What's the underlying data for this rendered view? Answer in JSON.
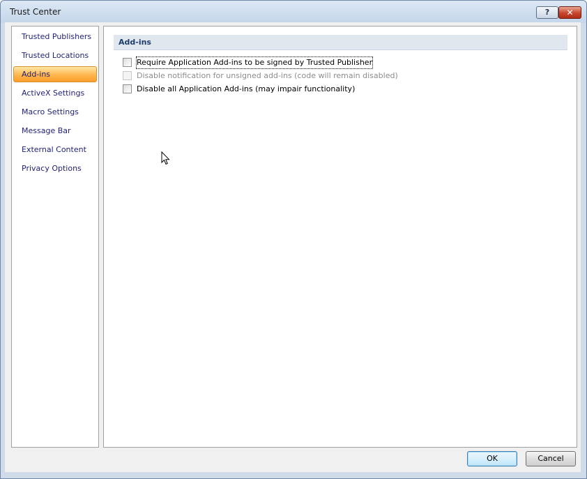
{
  "window": {
    "title": "Trust Center",
    "help_label": "?",
    "close_label": "✕"
  },
  "sidebar": {
    "items": [
      {
        "label": "Trusted Publishers",
        "selected": false
      },
      {
        "label": "Trusted Locations",
        "selected": false
      },
      {
        "label": "Add-ins",
        "selected": true
      },
      {
        "label": "ActiveX Settings",
        "selected": false
      },
      {
        "label": "Macro Settings",
        "selected": false
      },
      {
        "label": "Message Bar",
        "selected": false
      },
      {
        "label": "External Content",
        "selected": false
      },
      {
        "label": "Privacy Options",
        "selected": false
      }
    ]
  },
  "content": {
    "section_title": "Add-ins",
    "options": [
      {
        "label": "Require Application Add-ins to be signed by Trusted Publisher",
        "checked": false,
        "enabled": true,
        "focused": true
      },
      {
        "label": "Disable notification for unsigned add-ins (code will remain disabled)",
        "checked": false,
        "enabled": false,
        "focused": false
      },
      {
        "label": "Disable all Application Add-ins (may impair functionality)",
        "checked": false,
        "enabled": true,
        "focused": false
      }
    ]
  },
  "buttons": {
    "ok_label": "OK",
    "cancel_label": "Cancel"
  },
  "colors": {
    "selected_nav": "#ffb54d",
    "section_header_bg": "#e0e7ef",
    "nav_text": "#1f1f78"
  }
}
